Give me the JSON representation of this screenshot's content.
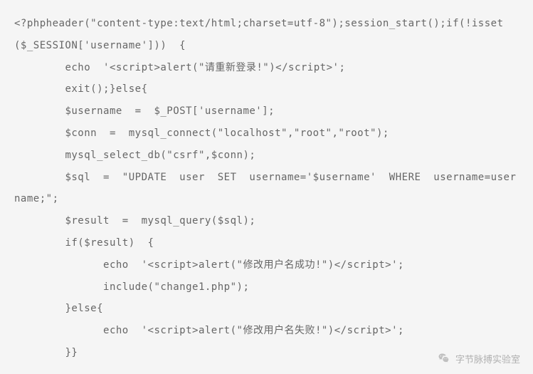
{
  "code": {
    "line1": "<?phpheader(\"content-type:text/html;charset=utf-8\");session_start();if(!isset($_SESSION['username']))  {",
    "line2": "        echo  '<script>alert(\"请重新登录!\")</script>';",
    "line3": "        exit();}else{",
    "line4": "        $username  =  $_POST['username'];",
    "line5": "        $conn  =  mysql_connect(\"localhost\",\"root\",\"root\");",
    "line6": "        mysql_select_db(\"csrf\",$conn);",
    "line7": "        $sql  =  \"UPDATE  user  SET  username='$username'  WHERE  username=username;\";",
    "line8": "        $result  =  mysql_query($sql);",
    "line9": "        if($result)  {",
    "line10": "              echo  '<script>alert(\"修改用户名成功!\")</script>';",
    "line11": "              include(\"change1.php\");",
    "line12": "        }else{",
    "line13": "              echo  '<script>alert(\"修改用户名失败!\")</script>';",
    "line14": "        }}"
  },
  "watermark": {
    "text": "字节脉搏实验室"
  }
}
